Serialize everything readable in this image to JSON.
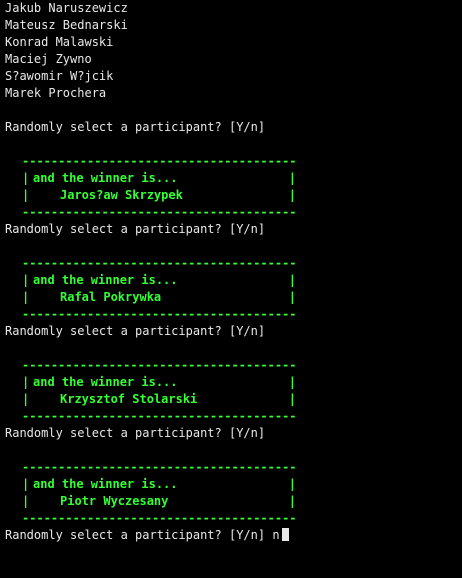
{
  "participants": [
    "Jakub Naruszewicz",
    "Mateusz Bednarski",
    "Konrad Malawski",
    "Maciej Zywno",
    "S?awomir W?jcik",
    "Marek Prochera"
  ],
  "prompt": "Randomly select a participant? [Y/n]",
  "box": {
    "rule": "----------------------------------------",
    "bar": "|",
    "intro": "and the winner is..."
  },
  "winners": [
    "Jaros?aw Skrzypek",
    "Rafal Pokrywka",
    "Krzysztof Stolarski",
    "Piotr Wyczesany"
  ],
  "last_answer": "n",
  "colors": {
    "background": "#000000",
    "text": "#e8e8e8",
    "accent": "#33ff33"
  }
}
